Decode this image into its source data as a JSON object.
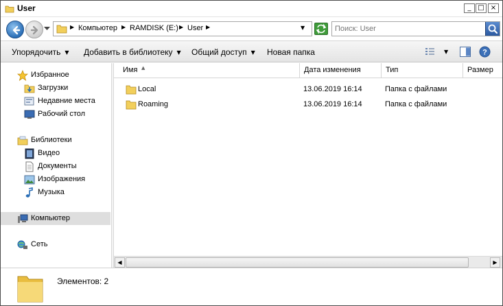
{
  "window": {
    "title": "User",
    "controls": {
      "minimize": "_",
      "maximize": "□",
      "close": "×"
    }
  },
  "address": {
    "breadcrumbs": [
      "Компьютер",
      "RAMDISK (E:)",
      "User"
    ],
    "search_placeholder": "Поиск: User"
  },
  "toolbar": {
    "organize": "Упорядочить",
    "add_to_library": "Добавить в библиотеку",
    "share": "Общий доступ",
    "new_folder": "Новая папка"
  },
  "sidebar": {
    "favorites": {
      "label": "Избранное",
      "items": [
        "Загрузки",
        "Недавние места",
        "Рабочий стол"
      ]
    },
    "libraries": {
      "label": "Библиотеки",
      "items": [
        "Видео",
        "Документы",
        "Изображения",
        "Музыка"
      ]
    },
    "computer": "Компьютер",
    "network": "Сеть"
  },
  "columns": [
    "Имя",
    "Дата изменения",
    "Тип",
    "Размер"
  ],
  "files": [
    {
      "name": "Local",
      "modified": "13.06.2019 16:14",
      "type": "Папка с файлами"
    },
    {
      "name": "Roaming",
      "modified": "13.06.2019 16:14",
      "type": "Папка с файлами"
    }
  ],
  "status": {
    "item_count": "Элементов: 2"
  },
  "colors": {
    "folder": "#f2cf5b",
    "selection": "#dedede",
    "accent": "#2b6fb7"
  }
}
